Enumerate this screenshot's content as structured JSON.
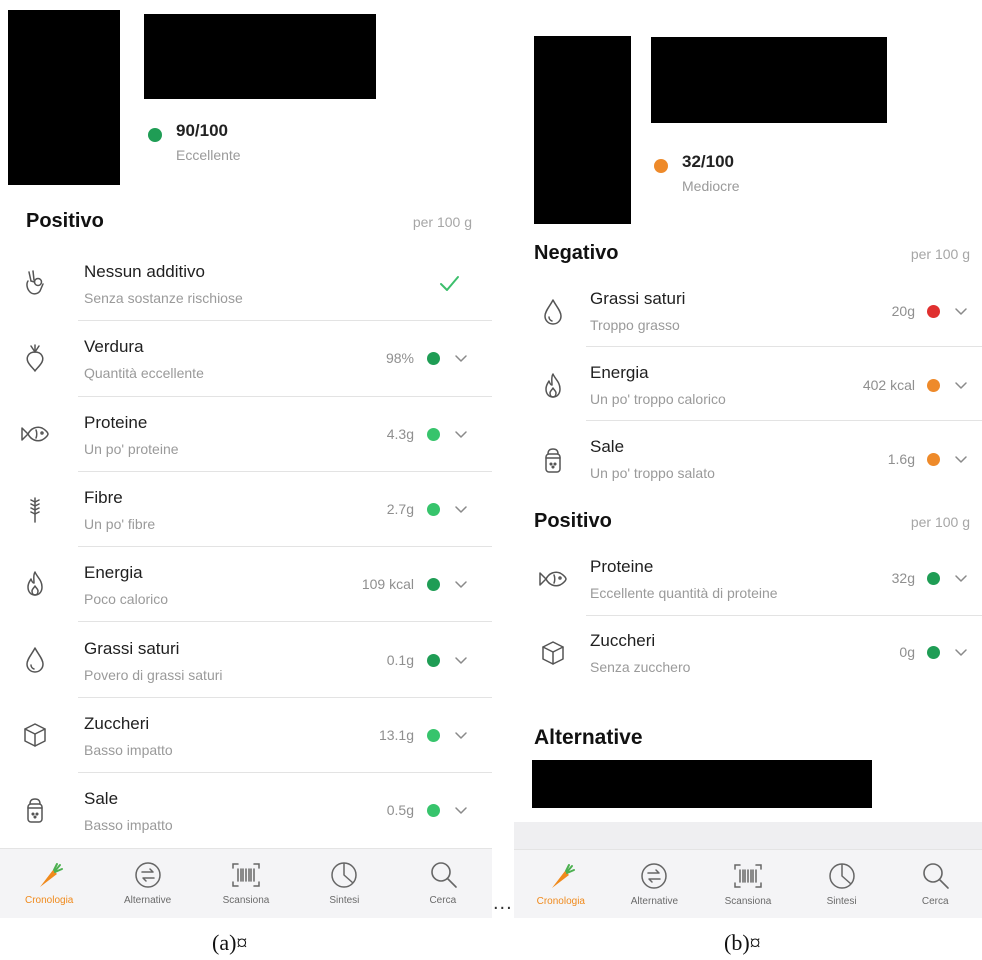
{
  "panel_a": {
    "score": {
      "value": "90/100",
      "rating": "Eccellente",
      "color": "#1f9d55"
    },
    "section": {
      "title": "Positivo",
      "per": "per 100 g"
    },
    "rows": [
      {
        "icon": "hand-ok-icon",
        "name": "Nessun additivo",
        "desc": "Senza sostanze rischiose",
        "value": "",
        "dot": "",
        "check": true
      },
      {
        "icon": "beet-icon",
        "name": "Verdura",
        "desc": "Quantità eccellente",
        "value": "98%",
        "dot": "#1f9d55"
      },
      {
        "icon": "fish-icon",
        "name": "Proteine",
        "desc": "Un po' proteine",
        "value": "4.3g",
        "dot": "#37c46c"
      },
      {
        "icon": "wheat-icon",
        "name": "Fibre",
        "desc": "Un po' fibre",
        "value": "2.7g",
        "dot": "#37c46c"
      },
      {
        "icon": "flame-icon",
        "name": "Energia",
        "desc": "Poco calorico",
        "value": "109 kcal",
        "dot": "#1f9d55"
      },
      {
        "icon": "drop-icon",
        "name": "Grassi saturi",
        "desc": "Povero di grassi saturi",
        "value": "0.1g",
        "dot": "#1f9d55"
      },
      {
        "icon": "cube-icon",
        "name": "Zuccheri",
        "desc": "Basso impatto",
        "value": "13.1g",
        "dot": "#37c46c"
      },
      {
        "icon": "salt-icon",
        "name": "Sale",
        "desc": "Basso impatto",
        "value": "0.5g",
        "dot": "#37c46c"
      }
    ],
    "caption": "(a)¤"
  },
  "panel_b": {
    "score": {
      "value": "32/100",
      "rating": "Mediocre",
      "color": "#ee8a2a"
    },
    "negative": {
      "title": "Negativo",
      "per": "per 100 g"
    },
    "neg_rows": [
      {
        "icon": "drop-icon",
        "name": "Grassi saturi",
        "desc": "Troppo grasso",
        "value": "20g",
        "dot": "#e0302f"
      },
      {
        "icon": "flame-icon",
        "name": "Energia",
        "desc": "Un po' troppo calorico",
        "value": "402 kcal",
        "dot": "#ee8a2a"
      },
      {
        "icon": "salt-icon",
        "name": "Sale",
        "desc": "Un po' troppo salato",
        "value": "1.6g",
        "dot": "#ee8a2a"
      }
    ],
    "positive": {
      "title": "Positivo",
      "per": "per 100 g"
    },
    "pos_rows": [
      {
        "icon": "fish-icon",
        "name": "Proteine",
        "desc": "Eccellente quantità di proteine",
        "value": "32g",
        "dot": "#1f9d55"
      },
      {
        "icon": "cube-icon",
        "name": "Zuccheri",
        "desc": "Senza zucchero",
        "value": "0g",
        "dot": "#1f9d55"
      }
    ],
    "alternatives_title": "Alternative",
    "caption": "(b)¤"
  },
  "tabbar": {
    "tabs": [
      {
        "icon": "carrot-icon",
        "label": "Cronologia",
        "active": true
      },
      {
        "icon": "swap-icon",
        "label": "Alternative",
        "active": false
      },
      {
        "icon": "barcode-scan-icon",
        "label": "Scansiona",
        "active": false
      },
      {
        "icon": "pie-chart-icon",
        "label": "Sintesi",
        "active": false
      },
      {
        "icon": "search-icon",
        "label": "Cerca",
        "active": false
      }
    ],
    "accent": "#f08a1c"
  },
  "separator": "..."
}
